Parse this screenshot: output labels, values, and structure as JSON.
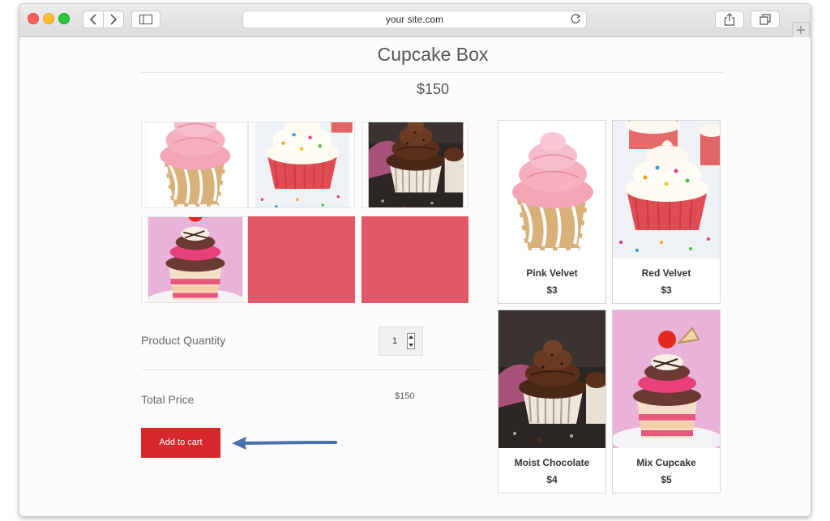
{
  "browser": {
    "url": "your site.com",
    "buttons": [
      "back",
      "forward",
      "sidebar",
      "reload",
      "share",
      "tabs",
      "new-tab"
    ]
  },
  "product": {
    "title": "Cupcake Box",
    "price": "$150"
  },
  "gallery": [
    {
      "image": "pink-frosted-cupcake-icon"
    },
    {
      "image": "red-velvet-sprinkles-cupcake-icon"
    },
    {
      "image": "chocolate-cupcake-icon"
    },
    {
      "image": "mix-cupcake-icon"
    },
    {
      "image": "empty-slot"
    },
    {
      "image": "empty-slot"
    }
  ],
  "form": {
    "quantity_label": "Product Quantity",
    "quantity_value": "1",
    "total_label": "Total Price",
    "total_value": "$150",
    "add_to_cart": "Add to cart"
  },
  "products": [
    {
      "name": "Pink Velvet",
      "price": "$3"
    },
    {
      "name": "Red Velvet",
      "price": "$3"
    },
    {
      "name": "Moist Chocolate",
      "price": "$4"
    },
    {
      "name": "Mix Cupcake",
      "price": "$5"
    }
  ],
  "colors": {
    "accent_red": "#d6282c",
    "empty_tile": "#e25868",
    "arrow_blue": "#4a6fb0"
  }
}
